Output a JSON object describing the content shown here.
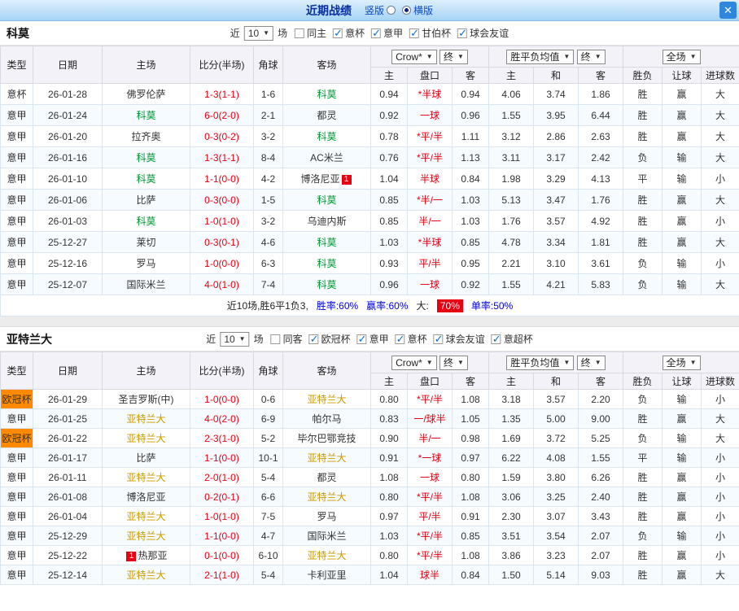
{
  "topbar": {
    "title": "近期战绩",
    "radio_options": [
      {
        "label": "竖版",
        "selected": false
      },
      {
        "label": "横版",
        "selected": true
      }
    ],
    "close_icon": "✕"
  },
  "colors": {
    "win_red": "#e60012",
    "loss_green": "#009933",
    "draw_blue": "#1e1ecc",
    "serie_a_blue": "#0043cc",
    "cup_green": "#009933",
    "ucl_orange_bg": "#ff8a00",
    "como_focus": "#009933",
    "atalanta_focus": "#cc9900"
  },
  "sections": [
    {
      "team": "科莫",
      "focus_color": "#009933",
      "filter": {
        "near_label": "近",
        "count": "10",
        "games_label": "场",
        "checkboxes": [
          {
            "label": "同主",
            "checked": false
          },
          {
            "label": "意杯",
            "checked": true
          },
          {
            "label": "意甲",
            "checked": true
          },
          {
            "label": "甘伯杯",
            "checked": true
          },
          {
            "label": "球会友谊",
            "checked": true
          }
        ]
      },
      "table": {
        "fixed_headers": [
          "类型",
          "日期",
          "主场",
          "比分(半场)",
          "角球",
          "客场"
        ],
        "group1": {
          "selects": [
            "Crow*",
            "终"
          ],
          "subs": [
            "主",
            "盘口",
            "客"
          ]
        },
        "group2": {
          "selects": [
            "胜平负均值",
            "终"
          ],
          "subs": [
            "主",
            "和",
            "客"
          ]
        },
        "group3": {
          "selects": [
            "全场"
          ],
          "subs": [
            "胜负",
            "让球",
            "进球数"
          ]
        }
      },
      "rows": [
        {
          "league": "意杯",
          "lstyle": "green",
          "date": "26-01-28",
          "home": {
            "name": "佛罗伦萨"
          },
          "score": "1-3(1-1)",
          "corner": "1-6",
          "away": {
            "name": "科莫",
            "focus": true
          },
          "odds": [
            "0.94",
            "*半球",
            "0.94"
          ],
          "avg": [
            "4.06",
            "3.74",
            "1.86"
          ],
          "res": [
            [
              "胜",
              "r"
            ],
            [
              "赢",
              "r"
            ],
            [
              "大",
              "r"
            ]
          ]
        },
        {
          "league": "意甲",
          "lstyle": "blue",
          "date": "26-01-24",
          "home": {
            "name": "科莫",
            "focus": true
          },
          "score": "6-0(2-0)",
          "corner": "2-1",
          "away": {
            "name": "都灵"
          },
          "odds": [
            "0.92",
            "一球",
            "0.96"
          ],
          "avg": [
            "1.55",
            "3.95",
            "6.44"
          ],
          "res": [
            [
              "胜",
              "r"
            ],
            [
              "赢",
              "r"
            ],
            [
              "大",
              "r"
            ]
          ]
        },
        {
          "league": "意甲",
          "lstyle": "blue",
          "date": "26-01-20",
          "home": {
            "name": "拉齐奥"
          },
          "score": "0-3(0-2)",
          "corner": "3-2",
          "away": {
            "name": "科莫",
            "focus": true
          },
          "odds": [
            "0.78",
            "*平/半",
            "1.11"
          ],
          "avg": [
            "3.12",
            "2.86",
            "2.63"
          ],
          "res": [
            [
              "胜",
              "r"
            ],
            [
              "赢",
              "r"
            ],
            [
              "大",
              "r"
            ]
          ]
        },
        {
          "league": "意甲",
          "lstyle": "blue",
          "date": "26-01-16",
          "home": {
            "name": "科莫",
            "focus": true
          },
          "score": "1-3(1-1)",
          "corner": "8-4",
          "away": {
            "name": "AC米兰"
          },
          "odds": [
            "0.76",
            "*平/半",
            "1.13"
          ],
          "avg": [
            "3.11",
            "3.17",
            "2.42"
          ],
          "res": [
            [
              "负",
              "b"
            ],
            [
              "输",
              "g"
            ],
            [
              "大",
              "r"
            ]
          ]
        },
        {
          "league": "意甲",
          "lstyle": "blue",
          "date": "26-01-10",
          "home": {
            "name": "科莫",
            "focus": true
          },
          "score": "1-1(0-0)",
          "corner": "4-2",
          "away": {
            "name": "博洛尼亚",
            "badge": "1",
            "badge_pos": "after"
          },
          "odds": [
            "1.04",
            "半球",
            "0.84"
          ],
          "avg": [
            "1.98",
            "3.29",
            "4.13"
          ],
          "res": [
            [
              "平",
              "b"
            ],
            [
              "输",
              "g"
            ],
            [
              "小",
              "g"
            ]
          ]
        },
        {
          "league": "意甲",
          "lstyle": "blue",
          "date": "26-01-06",
          "home": {
            "name": "比萨"
          },
          "score": "0-3(0-0)",
          "corner": "1-5",
          "away": {
            "name": "科莫",
            "focus": true
          },
          "odds": [
            "0.85",
            "*半/一",
            "1.03"
          ],
          "avg": [
            "5.13",
            "3.47",
            "1.76"
          ],
          "res": [
            [
              "胜",
              "r"
            ],
            [
              "赢",
              "r"
            ],
            [
              "大",
              "r"
            ]
          ]
        },
        {
          "league": "意甲",
          "lstyle": "blue",
          "date": "26-01-03",
          "home": {
            "name": "科莫",
            "focus": true
          },
          "score": "1-0(1-0)",
          "corner": "3-2",
          "away": {
            "name": "乌迪内斯"
          },
          "odds": [
            "0.85",
            "半/一",
            "1.03"
          ],
          "avg": [
            "1.76",
            "3.57",
            "4.92"
          ],
          "res": [
            [
              "胜",
              "r"
            ],
            [
              "赢",
              "r"
            ],
            [
              "小",
              "g"
            ]
          ]
        },
        {
          "league": "意甲",
          "lstyle": "blue",
          "date": "25-12-27",
          "home": {
            "name": "莱切"
          },
          "score": "0-3(0-1)",
          "corner": "4-6",
          "away": {
            "name": "科莫",
            "focus": true
          },
          "odds": [
            "1.03",
            "*半球",
            "0.85"
          ],
          "avg": [
            "4.78",
            "3.34",
            "1.81"
          ],
          "res": [
            [
              "胜",
              "r"
            ],
            [
              "赢",
              "r"
            ],
            [
              "大",
              "r"
            ]
          ]
        },
        {
          "league": "意甲",
          "lstyle": "blue",
          "date": "25-12-16",
          "home": {
            "name": "罗马"
          },
          "score": "1-0(0-0)",
          "corner": "6-3",
          "away": {
            "name": "科莫",
            "focus": true
          },
          "odds": [
            "0.93",
            "平/半",
            "0.95"
          ],
          "avg": [
            "2.21",
            "3.10",
            "3.61"
          ],
          "res": [
            [
              "负",
              "b"
            ],
            [
              "输",
              "g"
            ],
            [
              "小",
              "g"
            ]
          ]
        },
        {
          "league": "意甲",
          "lstyle": "blue",
          "date": "25-12-07",
          "home": {
            "name": "国际米兰"
          },
          "score": "4-0(1-0)",
          "corner": "7-4",
          "away": {
            "name": "科莫",
            "focus": true
          },
          "odds": [
            "0.96",
            "一球",
            "0.92"
          ],
          "avg": [
            "1.55",
            "4.21",
            "5.83"
          ],
          "res": [
            [
              "负",
              "b"
            ],
            [
              "输",
              "g"
            ],
            [
              "大",
              "r"
            ]
          ]
        }
      ],
      "summary": [
        {
          "t": "近10场,胜6平1负3,",
          "c": "black"
        },
        {
          "t": "胜率:60%",
          "c": "blue"
        },
        {
          "t": "赢率:60%",
          "c": "blue"
        },
        {
          "t": "大:",
          "c": "black"
        },
        {
          "t": "70%",
          "c": "redbg"
        },
        {
          "t": "单率:50%",
          "c": "blue"
        }
      ]
    },
    {
      "team": "亚特兰大",
      "focus_color": "#cc9900",
      "filter": {
        "near_label": "近",
        "count": "10",
        "games_label": "场",
        "checkboxes": [
          {
            "label": "同客",
            "checked": false
          },
          {
            "label": "欧冠杯",
            "checked": true
          },
          {
            "label": "意甲",
            "checked": true
          },
          {
            "label": "意杯",
            "checked": true
          },
          {
            "label": "球会友谊",
            "checked": true
          },
          {
            "label": "意超杯",
            "checked": true
          }
        ]
      },
      "table": {
        "fixed_headers": [
          "类型",
          "日期",
          "主场",
          "比分(半场)",
          "角球",
          "客场"
        ],
        "group1": {
          "selects": [
            "Crow*",
            "终"
          ],
          "subs": [
            "主",
            "盘口",
            "客"
          ]
        },
        "group2": {
          "selects": [
            "胜平负均值",
            "终"
          ],
          "subs": [
            "主",
            "和",
            "客"
          ]
        },
        "group3": {
          "selects": [
            "全场"
          ],
          "subs": [
            "胜负",
            "让球",
            "进球数"
          ]
        }
      },
      "rows": [
        {
          "league": "欧冠杯",
          "lstyle": "ucl",
          "date": "26-01-29",
          "home": {
            "name": "圣吉罗斯(中)"
          },
          "score": "1-0(0-0)",
          "corner": "0-6",
          "away": {
            "name": "亚特兰大",
            "focus": true
          },
          "odds": [
            "0.80",
            "*平/半",
            "1.08"
          ],
          "avg": [
            "3.18",
            "3.57",
            "2.20"
          ],
          "res": [
            [
              "负",
              "b"
            ],
            [
              "输",
              "g"
            ],
            [
              "小",
              "g"
            ]
          ]
        },
        {
          "league": "意甲",
          "lstyle": "blue",
          "date": "26-01-25",
          "home": {
            "name": "亚特兰大",
            "focus": true
          },
          "score": "4-0(2-0)",
          "corner": "6-9",
          "away": {
            "name": "帕尔马"
          },
          "odds": [
            "0.83",
            "一/球半",
            "1.05"
          ],
          "avg": [
            "1.35",
            "5.00",
            "9.00"
          ],
          "res": [
            [
              "胜",
              "r"
            ],
            [
              "赢",
              "r"
            ],
            [
              "大",
              "r"
            ]
          ]
        },
        {
          "league": "欧冠杯",
          "lstyle": "ucl",
          "date": "26-01-22",
          "home": {
            "name": "亚特兰大",
            "focus": true
          },
          "score": "2-3(1-0)",
          "corner": "5-2",
          "away": {
            "name": "毕尔巴鄂竞技"
          },
          "odds": [
            "0.90",
            "半/一",
            "0.98"
          ],
          "avg": [
            "1.69",
            "3.72",
            "5.25"
          ],
          "res": [
            [
              "负",
              "b"
            ],
            [
              "输",
              "g"
            ],
            [
              "大",
              "r"
            ]
          ]
        },
        {
          "league": "意甲",
          "lstyle": "blue",
          "date": "26-01-17",
          "home": {
            "name": "比萨"
          },
          "score": "1-1(0-0)",
          "corner": "10-1",
          "away": {
            "name": "亚特兰大",
            "focus": true
          },
          "odds": [
            "0.91",
            "*一球",
            "0.97"
          ],
          "avg": [
            "6.22",
            "4.08",
            "1.55"
          ],
          "res": [
            [
              "平",
              "b"
            ],
            [
              "输",
              "g"
            ],
            [
              "小",
              "g"
            ]
          ]
        },
        {
          "league": "意甲",
          "lstyle": "blue",
          "date": "26-01-11",
          "home": {
            "name": "亚特兰大",
            "focus": true
          },
          "score": "2-0(1-0)",
          "corner": "5-4",
          "away": {
            "name": "都灵"
          },
          "odds": [
            "1.08",
            "一球",
            "0.80"
          ],
          "avg": [
            "1.59",
            "3.80",
            "6.26"
          ],
          "res": [
            [
              "胜",
              "r"
            ],
            [
              "赢",
              "r"
            ],
            [
              "小",
              "g"
            ]
          ]
        },
        {
          "league": "意甲",
          "lstyle": "blue",
          "date": "26-01-08",
          "home": {
            "name": "博洛尼亚"
          },
          "score": "0-2(0-1)",
          "corner": "6-6",
          "away": {
            "name": "亚特兰大",
            "focus": true
          },
          "odds": [
            "0.80",
            "*平/半",
            "1.08"
          ],
          "avg": [
            "3.06",
            "3.25",
            "2.40"
          ],
          "res": [
            [
              "胜",
              "r"
            ],
            [
              "赢",
              "r"
            ],
            [
              "小",
              "g"
            ]
          ]
        },
        {
          "league": "意甲",
          "lstyle": "blue",
          "date": "26-01-04",
          "home": {
            "name": "亚特兰大",
            "focus": true
          },
          "score": "1-0(1-0)",
          "corner": "7-5",
          "away": {
            "name": "罗马"
          },
          "odds": [
            "0.97",
            "平/半",
            "0.91"
          ],
          "avg": [
            "2.30",
            "3.07",
            "3.43"
          ],
          "res": [
            [
              "胜",
              "r"
            ],
            [
              "赢",
              "r"
            ],
            [
              "小",
              "g"
            ]
          ]
        },
        {
          "league": "意甲",
          "lstyle": "blue",
          "date": "25-12-29",
          "home": {
            "name": "亚特兰大",
            "focus": true
          },
          "score": "1-1(0-0)",
          "corner": "4-7",
          "away": {
            "name": "国际米兰"
          },
          "odds": [
            "1.03",
            "*平/半",
            "0.85"
          ],
          "avg": [
            "3.51",
            "3.54",
            "2.07"
          ],
          "res": [
            [
              "负",
              "b"
            ],
            [
              "输",
              "g"
            ],
            [
              "小",
              "g"
            ]
          ]
        },
        {
          "league": "意甲",
          "lstyle": "blue",
          "date": "25-12-22",
          "home": {
            "name": "热那亚",
            "badge": "1",
            "badge_pos": "before"
          },
          "score": "0-1(0-0)",
          "corner": "6-10",
          "away": {
            "name": "亚特兰大",
            "focus": true
          },
          "odds": [
            "0.80",
            "*平/半",
            "1.08"
          ],
          "avg": [
            "3.86",
            "3.23",
            "2.07"
          ],
          "res": [
            [
              "胜",
              "r"
            ],
            [
              "赢",
              "r"
            ],
            [
              "小",
              "g"
            ]
          ]
        },
        {
          "league": "意甲",
          "lstyle": "blue",
          "date": "25-12-14",
          "home": {
            "name": "亚特兰大",
            "focus": true
          },
          "score": "2-1(1-0)",
          "corner": "5-4",
          "away": {
            "name": "卡利亚里"
          },
          "odds": [
            "1.04",
            "球半",
            "0.84"
          ],
          "avg": [
            "1.50",
            "5.14",
            "9.03"
          ],
          "res": [
            [
              "胜",
              "r"
            ],
            [
              "赢",
              "r"
            ],
            [
              "大",
              "r"
            ]
          ]
        }
      ],
      "summary": null
    }
  ]
}
